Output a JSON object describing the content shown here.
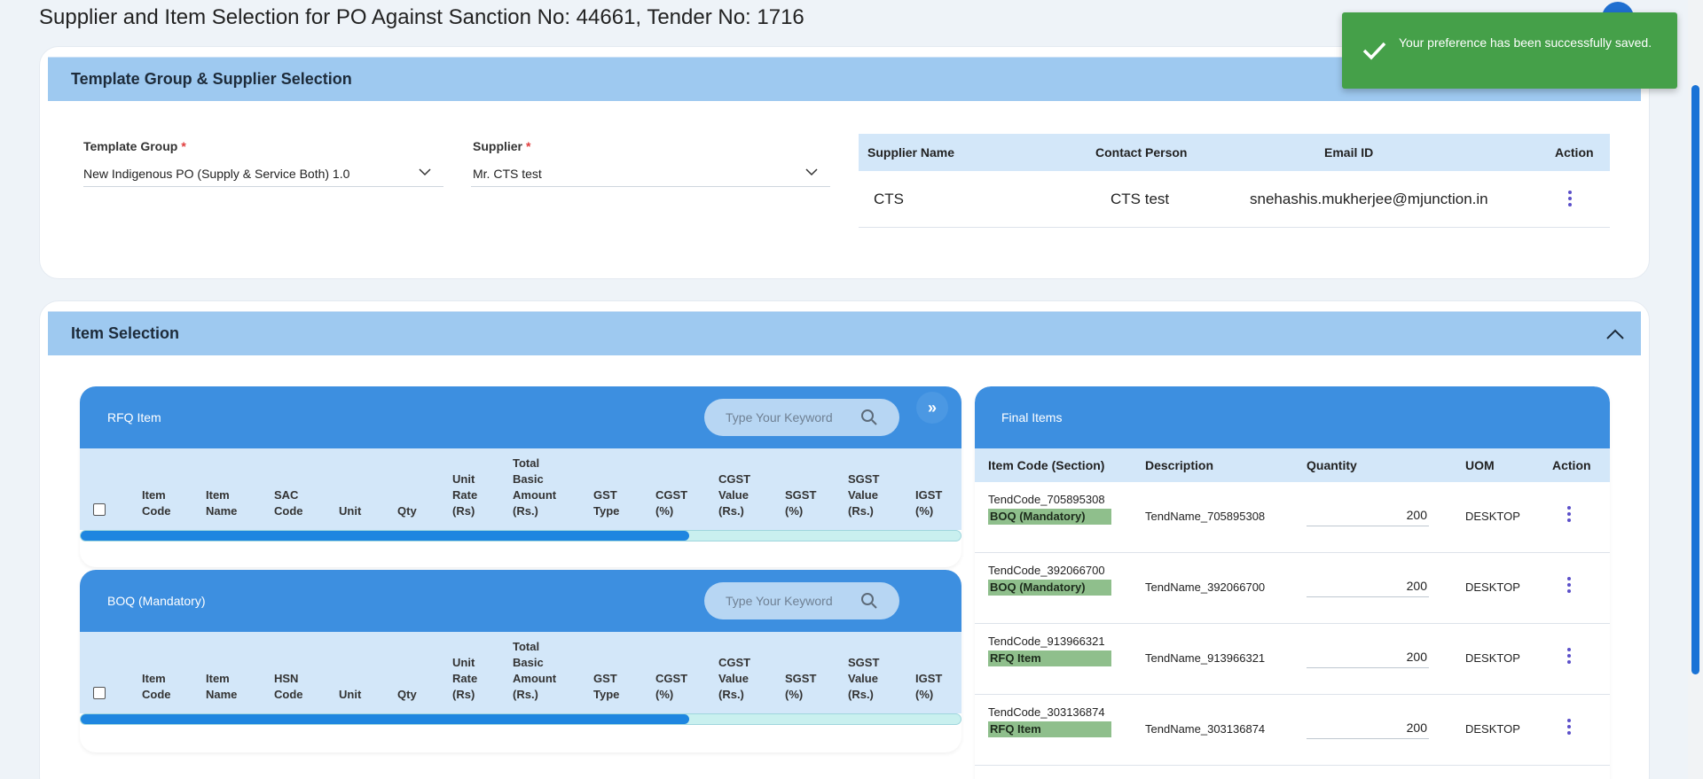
{
  "page": {
    "title": "Supplier and Item Selection for PO Against Sanction No: 44661, Tender No: 1716"
  },
  "toast": {
    "message": "Your preference has been successfully saved.",
    "icon": "check-icon",
    "color": "#45a049"
  },
  "template_section": {
    "header": "Template Group & Supplier Selection",
    "template_group": {
      "label": "Template Group",
      "required_mark": "*",
      "value": "New Indigenous PO (Supply & Service Both) 1.0"
    },
    "supplier": {
      "label": "Supplier",
      "required_mark": "*",
      "value": "Mr. CTS test"
    },
    "supplier_table": {
      "columns": [
        "Supplier Name",
        "Contact Person",
        "Email ID",
        "Action"
      ],
      "rows": [
        {
          "name": "CTS",
          "contact": "CTS test",
          "email": "snehashis.mukherjee@mjunction.in"
        }
      ]
    }
  },
  "item_section": {
    "header": "Item Selection",
    "rfq_panel": {
      "title": "RFQ Item",
      "search_placeholder": "Type Your Keyword",
      "columns": [
        "Item\nCode",
        "Item\nName",
        "SAC\nCode",
        "Unit",
        "Qty",
        "Unit\nRate\n(Rs)",
        "Total\nBasic\nAmount\n(Rs.)",
        "GST\nType",
        "CGST\n(%)",
        "CGST\nValue\n(Rs.)",
        "SGST\n(%)",
        "SGST\nValue\n(Rs.)",
        "IGST\n(%)"
      ]
    },
    "boq_panel": {
      "title": "BOQ (Mandatory)",
      "search_placeholder": "Type Your Keyword",
      "columns": [
        "Item\nCode",
        "Item\nName",
        "HSN\nCode",
        "Unit",
        "Qty",
        "Unit\nRate\n(Rs)",
        "Total\nBasic\nAmount\n(Rs.)",
        "GST\nType",
        "CGST\n(%)",
        "CGST\nValue\n(Rs.)",
        "SGST\n(%)",
        "SGST\nValue\n(Rs.)",
        "IGST\n(%)"
      ]
    },
    "move_button": "»",
    "final_panel": {
      "title": "Final Items",
      "columns": [
        "Item Code (Section)",
        "Description",
        "Quantity",
        "UOM",
        "Action"
      ],
      "rows": [
        {
          "code": "TendCode_705895308",
          "section": "BOQ (Mandatory)",
          "desc": "TendName_705895308",
          "qty": "200",
          "uom": "DESKTOP"
        },
        {
          "code": "TendCode_392066700",
          "section": "BOQ (Mandatory)",
          "desc": "TendName_392066700",
          "qty": "200",
          "uom": "DESKTOP"
        },
        {
          "code": "TendCode_913966321",
          "section": "RFQ Item",
          "desc": "TendName_913966321",
          "qty": "200",
          "uom": "DESKTOP"
        },
        {
          "code": "TendCode_303136874",
          "section": "RFQ Item",
          "desc": "TendName_303136874",
          "qty": "200",
          "uom": "DESKTOP"
        }
      ]
    }
  }
}
